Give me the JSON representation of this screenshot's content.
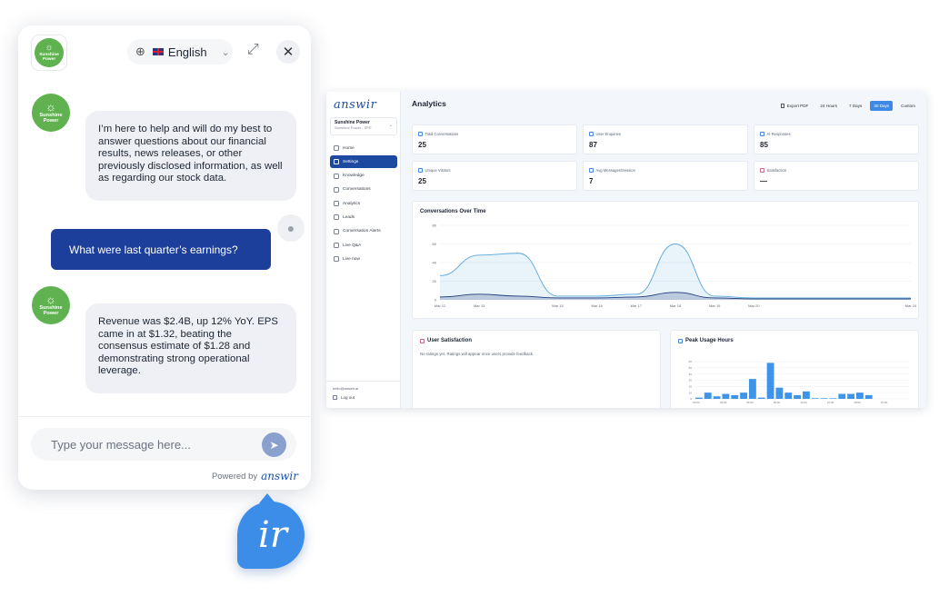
{
  "dashboard": {
    "logo": "answir",
    "org": {
      "name": "Sunshine Power",
      "sub": "Sunshine Power - SPE"
    },
    "nav": [
      {
        "label": "Home",
        "active": false
      },
      {
        "label": "Settings",
        "active": true
      },
      {
        "label": "Knowledge",
        "active": false
      },
      {
        "label": "Conversations",
        "active": false
      },
      {
        "label": "Analytics",
        "active": false
      },
      {
        "label": "Leads",
        "active": false
      },
      {
        "label": "Conversation Alerts",
        "active": false
      },
      {
        "label": "Live Q&A",
        "active": false
      },
      {
        "label": "Live now",
        "active": false
      }
    ],
    "footer": {
      "email": "hello@answir.ai",
      "logout": "Log out"
    },
    "title": "Analytics",
    "toolbar": {
      "export": "Export PDF",
      "ranges": [
        "24 Hours",
        "7 Days",
        "30 Days",
        "Custom"
      ],
      "selected": "30 Days"
    },
    "stats": [
      {
        "label": "Total Conversations",
        "value": "25"
      },
      {
        "label": "User Enquiries",
        "value": "87"
      },
      {
        "label": "AI Responses",
        "value": "85"
      },
      {
        "label": "Unique Visitors",
        "value": "25"
      },
      {
        "label": "Avg Messages/Session",
        "value": "7"
      },
      {
        "label": "Satisfaction",
        "value": "—"
      }
    ],
    "satisfaction": {
      "title": "User Satisfaction",
      "message": "No ratings yet. Ratings will appear once users provide feedback."
    },
    "peak": {
      "title": "Peak Usage Hours"
    }
  },
  "chart_data": [
    {
      "type": "area",
      "title": "Conversations Over Time",
      "x": [
        "Mar 12",
        "Mar 13",
        "Mar 14",
        "Mar 15",
        "Mar 16",
        "Mar 17",
        "Mar 18",
        "Mar 19",
        "Mar 20",
        "Mar 21",
        "Mar 22",
        "Mar 23",
        "Mar 24"
      ],
      "xticks": [
        "Mar 12",
        "Mar 13",
        "Mar 15",
        "Mar 16",
        "Mar 17",
        "Mar 18",
        "Mar 19",
        "Mar 20",
        "Mar 24"
      ],
      "yticks": [
        0,
        20,
        40,
        60,
        80
      ],
      "ylim": [
        0,
        80
      ],
      "series": [
        {
          "values": [
            26,
            48,
            50,
            4,
            4,
            6,
            60,
            4,
            2,
            2,
            2,
            2,
            2
          ],
          "color": "#5aa7df"
        },
        {
          "values": [
            3,
            6,
            4,
            2,
            2,
            3,
            8,
            2,
            1,
            1,
            1,
            1,
            1
          ],
          "color": "#1f3a7a"
        }
      ],
      "grid": true
    },
    {
      "type": "bar",
      "title": "Peak Usage Hours",
      "values": [
        2,
        10,
        4,
        8,
        6,
        10,
        32,
        2,
        58,
        18,
        10,
        6,
        12,
        1,
        1,
        1,
        8,
        8,
        10,
        6
      ],
      "ylim": [
        0,
        60
      ],
      "yticks": [
        0,
        10,
        20,
        30,
        40,
        50,
        60
      ],
      "xticks": [
        "00:00",
        "03:00",
        "06:00",
        "09:00",
        "12:00",
        "15:00",
        "18:00",
        "21:00"
      ],
      "color": "#3d94e8",
      "grid": true
    }
  ],
  "chat": {
    "brand": "Sunshine Power",
    "language": "English",
    "messages": [
      {
        "role": "bot",
        "text": "I’m here to help and will do my best to answer questions about our financial results, news releases, or other previously disclosed information, as well as regarding our stock data."
      },
      {
        "role": "user",
        "text": "What were last quarter’s earnings?"
      },
      {
        "role": "bot",
        "text": "Revenue was $2.4B, up 12% YoY. EPS came in at $1.32, beating the consensus estimate of $1.28 and demonstrating strong operational leverage."
      }
    ],
    "input_placeholder": "Type your message here...",
    "powered_by": "Powered by",
    "powered_logo": "answir",
    "launcher": "ir"
  },
  "colors": {
    "brand_green": "#5fb24f",
    "primary_blue": "#1d3f9c",
    "accent_blue": "#3b8de8"
  }
}
